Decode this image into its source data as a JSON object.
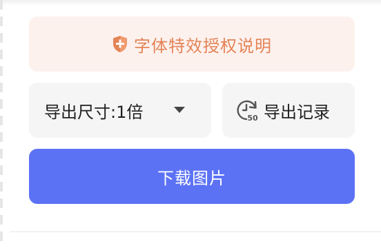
{
  "license": {
    "label": "字体特效授权说明",
    "icon": "shield-icon",
    "color": "#e48456",
    "background": "#fdf1ee"
  },
  "export_size": {
    "label": "导出尺寸:1倍",
    "icon": "caret-down-icon"
  },
  "export_history": {
    "label": "导出记录",
    "icon": "history-icon",
    "icon_badge": "50"
  },
  "download": {
    "label": "下载图片",
    "background": "#5c72f5"
  }
}
